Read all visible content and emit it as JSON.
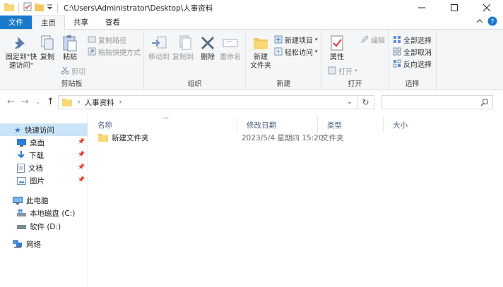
{
  "titlebar": {
    "path": "C:\\Users\\Administrator\\Desktop\\人事资料",
    "minimize": "minimize",
    "maximize": "maximize",
    "close": "close"
  },
  "tabs": {
    "file": "文件",
    "home": "主页",
    "share": "共享",
    "view": "查看"
  },
  "ribbon": {
    "clipboard": {
      "label": "剪贴板",
      "pin_quick_line1": "固定到\"快",
      "pin_quick_line2": "速访问\"",
      "copy": "复制",
      "paste": "粘贴",
      "copy_path": "复制路径",
      "paste_shortcut": "粘贴快捷方式",
      "cut": "剪切"
    },
    "organize": {
      "label": "组织",
      "move_to": "移动到",
      "copy_to": "复制到",
      "delete": "删除",
      "rename": "重命名"
    },
    "new": {
      "label": "新建",
      "new_folder_line1": "新建",
      "new_folder_line2": "文件夹",
      "new_item": "新建项目",
      "easy_access": "轻松访问"
    },
    "open": {
      "label": "打开",
      "properties": "属性",
      "open": "打开",
      "edit": "编辑"
    },
    "select": {
      "label": "选择",
      "select_all": "全部选择",
      "select_none": "全部取消",
      "invert": "反向选择"
    }
  },
  "address": {
    "crumb": "人事资料"
  },
  "nav": {
    "quick_access": "快速访问",
    "desktop": "桌面",
    "downloads": "下载",
    "documents": "文档",
    "pictures": "图片",
    "this_pc": "此电脑",
    "local_disk": "本地磁盘 (C:)",
    "software": "软件 (D:)",
    "network": "网络"
  },
  "columns": {
    "name": "名称",
    "modified": "修改日期",
    "type": "类型",
    "size": "大小"
  },
  "files": [
    {
      "name": "新建文件夹",
      "modified": "2023/5/4 星期四 15:20",
      "type": "文件夹",
      "size": ""
    }
  ],
  "colors": {
    "accent": "#1979ca",
    "folder": "#f3c75f",
    "selected": "#cce4f7"
  }
}
